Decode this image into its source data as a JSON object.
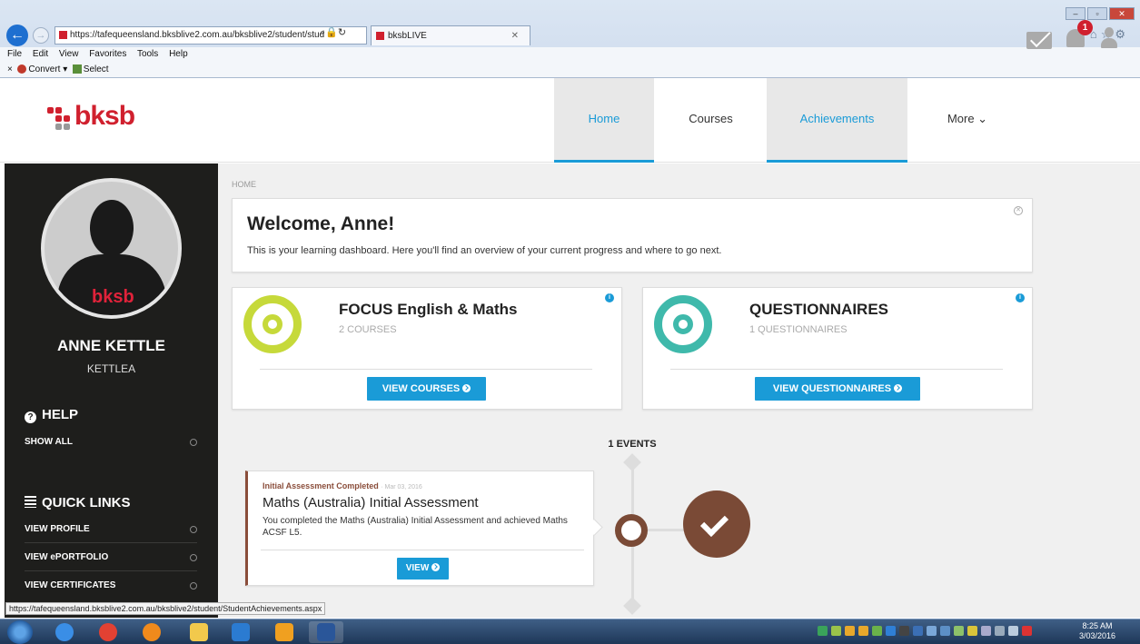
{
  "browser": {
    "url": "https://tafequeensland.bksblive2.com.au/bksblive2/student/stud",
    "tab_title": "bksbLIVE",
    "menu": [
      "File",
      "Edit",
      "View",
      "Favorites",
      "Tools",
      "Help"
    ],
    "toolbar": {
      "close": "×",
      "convert": "Convert",
      "select": "Select"
    },
    "status_url": "https://tafequeensland.bksblive2.com.au/bksblive2/student/StudentAchievements.aspx"
  },
  "header": {
    "logo_text": "bksb",
    "nav": {
      "home": "Home",
      "courses": "Courses",
      "achievements": "Achievements",
      "more": "More ⌄"
    },
    "notification_count": "1"
  },
  "sidebar": {
    "avatar_logo": "bksb",
    "name": "ANNE KETTLE",
    "username": "KETTLEA",
    "help_heading": "HELP",
    "help_items": [
      "SHOW ALL"
    ],
    "quick_links_heading": "QUICK LINKS",
    "quick_links": [
      "VIEW PROFILE",
      "VIEW ePORTFOLIO",
      "VIEW CERTIFICATES"
    ]
  },
  "main": {
    "breadcrumb": "HOME",
    "welcome_title": "Welcome, Anne!",
    "welcome_text": "This is your learning dashboard. Here you'll find an overview of your current progress and where to go next.",
    "focus": {
      "title": "FOCUS English & Maths",
      "subtitle": "2 COURSES",
      "button": "VIEW COURSES"
    },
    "questionnaires": {
      "title": "QUESTIONNAIRES",
      "subtitle": "1 QUESTIONNAIRES",
      "button": "VIEW QUESTIONNAIRES"
    },
    "events_label": "1 EVENTS",
    "event": {
      "type": "Initial Assessment Completed",
      "date": "· Mar 03, 2016",
      "title": "Maths (Australia) Initial Assessment",
      "description": "You completed the Maths (Australia) Initial Assessment and achieved Maths ACSF L5.",
      "button": "VIEW"
    }
  },
  "taskbar": {
    "time": "8:25 AM",
    "date": "3/03/2016"
  },
  "colors": {
    "brand_red": "#d0202e",
    "accent_blue": "#1a9bd7",
    "focus_green": "#c6d93a",
    "quest_teal": "#3fb9ab",
    "event_brown": "#7a4a36",
    "sidebar": "#1e1e1c"
  }
}
